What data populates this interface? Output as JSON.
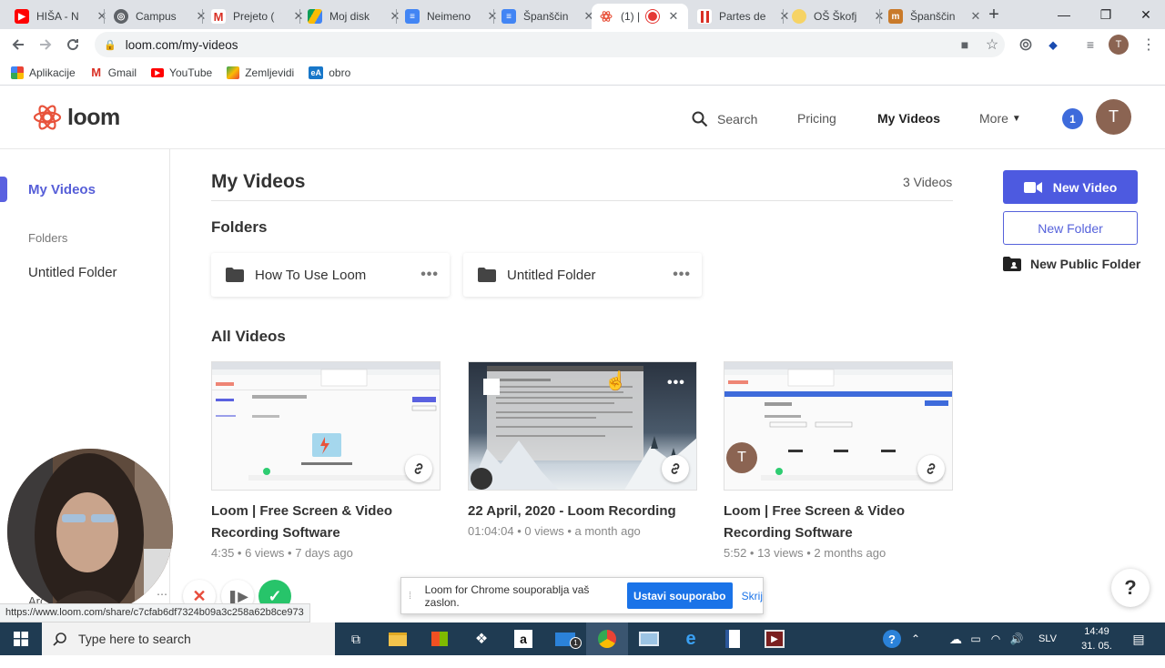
{
  "browser": {
    "tabs": [
      {
        "label": "HIŠA - N",
        "icon": "youtube-icon",
        "color": "#ff0000"
      },
      {
        "label": "Campus",
        "icon": "globe-icon",
        "color": "#5f6368"
      },
      {
        "label": "Prejeto (",
        "icon": "gmail-icon",
        "color": "#d93025"
      },
      {
        "label": "Moj disk",
        "icon": "google-drive-icon",
        "color": "#fbbc04"
      },
      {
        "label": "Neimeno",
        "icon": "google-docs-icon",
        "color": "#4285f4"
      },
      {
        "label": "Španščin",
        "icon": "google-docs-icon",
        "color": "#4285f4"
      },
      {
        "label": "(1) |",
        "icon": "loom-icon",
        "color": "#e8533c"
      },
      {
        "label": "Partes de",
        "icon": "pause-icon",
        "color": "#d93025"
      },
      {
        "label": "OŠ Škofj",
        "icon": "school-icon",
        "color": "#f6b93b"
      },
      {
        "label": "Španščin",
        "icon": "school-icon",
        "color": "#c97a2a"
      }
    ],
    "url": "loom.com/my-videos",
    "profile_initial": "T",
    "bookmarks": [
      {
        "label": "Aplikacije",
        "icon": "apps-grid-icon"
      },
      {
        "label": "Gmail",
        "icon": "gmail-icon"
      },
      {
        "label": "YouTube",
        "icon": "youtube-icon"
      },
      {
        "label": "Zemljevidi",
        "icon": "maps-icon"
      },
      {
        "label": "obro",
        "icon": "ea-icon"
      }
    ]
  },
  "loom": {
    "logo_text": "loom",
    "nav": {
      "search": "Search",
      "pricing": "Pricing",
      "my_videos": "My Videos",
      "more": "More"
    },
    "notification_count": "1",
    "avatar_initial": "T",
    "sidebar": {
      "my_videos": "My Videos",
      "folders_label": "Folders",
      "folder_item": "Untitled Folder"
    },
    "main": {
      "title": "My Videos",
      "video_count": "3 Videos",
      "folders_heading": "Folders",
      "folders": [
        "How To Use Loom",
        "Untitled Folder"
      ],
      "all_videos_heading": "All Videos",
      "videos": [
        {
          "title": "Loom | Free Screen & Video Recording Software",
          "meta": "4:35 • 6 views • 7 days ago"
        },
        {
          "title": "22 April, 2020 - Loom Recording",
          "meta": "01:04:04 • 0 views • a month ago"
        },
        {
          "title": "Loom | Free Screen & Video Recording Software",
          "meta": "5:52 • 13 views • 2 months ago",
          "avatar_initial": "T"
        }
      ]
    },
    "actions": {
      "new_video": "New Video",
      "new_folder": "New Folder",
      "new_public_folder": "New Public Folder"
    },
    "help": "?",
    "share_bar": {
      "text": "Loom for Chrome souporablja vaš zaslon.",
      "stop": "Ustavi souporabo",
      "hide": "Skrij"
    },
    "status_url": "https://www.loom.com/share/c7cfab6df7324b09a3c258a62b8ce973",
    "sidebar_cut_text": "Arc"
  },
  "taskbar": {
    "search_placeholder": "Type here to search",
    "language": "SLV",
    "time": "14:49",
    "date": "31. 05. 2020",
    "mail_badge": "1"
  },
  "colors": {
    "loom_purple": "#5a61e0",
    "loom_blue": "#4d5ae0",
    "loom_red": "#e8533c",
    "taskbar": "#1f3b52"
  }
}
